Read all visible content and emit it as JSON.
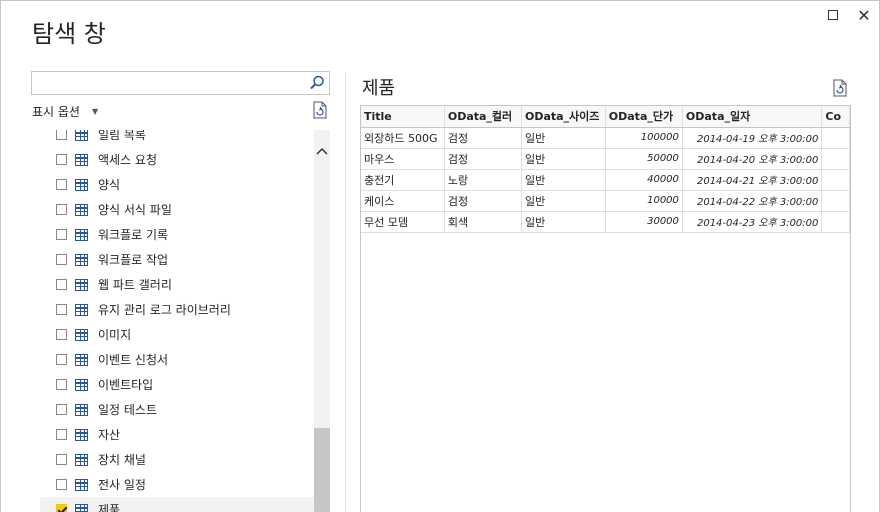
{
  "window": {
    "title": "탐색 창",
    "maximize_label": "",
    "close_label": "✕"
  },
  "left": {
    "search": {
      "value": "",
      "placeholder": ""
    },
    "display_options_label": "표시 옵션",
    "items": [
      {
        "label": "일림 목록",
        "checked": false
      },
      {
        "label": "액세스 요청",
        "checked": false
      },
      {
        "label": "양식",
        "checked": false
      },
      {
        "label": "양식 서식 파일",
        "checked": false
      },
      {
        "label": "워크플로 기록",
        "checked": false
      },
      {
        "label": "워크플로 작업",
        "checked": false
      },
      {
        "label": "웹 파트 갤러리",
        "checked": false
      },
      {
        "label": "유지 관리 로그 라이브러리",
        "checked": false
      },
      {
        "label": "이미지",
        "checked": false
      },
      {
        "label": "이벤트 신청서",
        "checked": false
      },
      {
        "label": "이벤트타입",
        "checked": false
      },
      {
        "label": "일정 테스트",
        "checked": false
      },
      {
        "label": "자산",
        "checked": false
      },
      {
        "label": "장치 채널",
        "checked": false
      },
      {
        "label": "전사 일정",
        "checked": false
      },
      {
        "label": "제품",
        "checked": true
      }
    ]
  },
  "preview": {
    "title": "제품",
    "columns": [
      "Title",
      "OData_컬러",
      "OData_사이즈",
      "OData_단가",
      "OData_일자",
      "Co"
    ],
    "rows": [
      [
        "외장하드 500G",
        "검정",
        "일반",
        "100000",
        "2014-04-19 오후 3:00:00",
        ""
      ],
      [
        "마우스",
        "검정",
        "일반",
        "50000",
        "2014-04-20 오후 3:00:00",
        ""
      ],
      [
        "충전기",
        "노랑",
        "일반",
        "40000",
        "2014-04-21 오후 3:00:00",
        ""
      ],
      [
        "케이스",
        "검정",
        "일반",
        "10000",
        "2014-04-22 오후 3:00:00",
        ""
      ],
      [
        "무선 모뎀",
        "회색",
        "일반",
        "30000",
        "2014-04-23 오후 3:00:00",
        ""
      ]
    ]
  },
  "colors": {
    "accent_check": "#f2c811",
    "table_icon": "#2b579a"
  },
  "icons": {
    "search": "search-icon",
    "refresh": "refresh-icon",
    "table": "table-icon"
  }
}
